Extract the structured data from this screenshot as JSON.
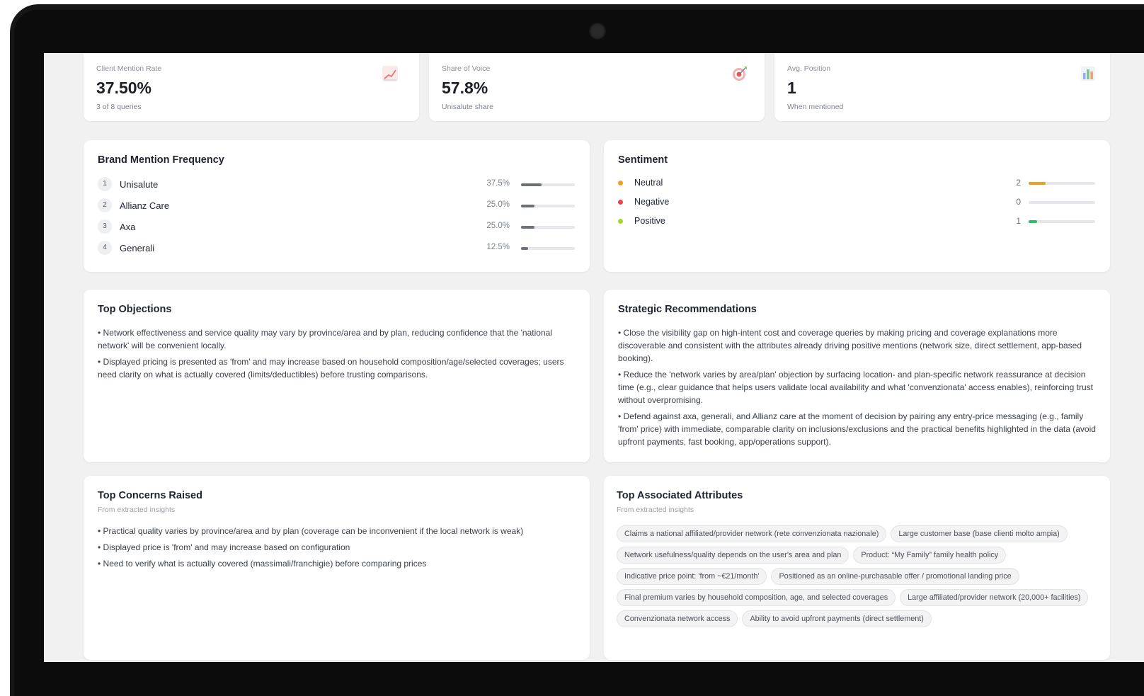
{
  "kpis": [
    {
      "label": "Client Mention Rate",
      "value": "37.50%",
      "sub": "3 of 8 queries",
      "icon": "trend-line-icon"
    },
    {
      "label": "Share of Voice",
      "value": "57.8%",
      "sub": "Unisalute share",
      "icon": "target-icon"
    },
    {
      "label": "Avg. Position",
      "value": "1",
      "sub": "When mentioned",
      "icon": "bar-chart-icon"
    }
  ],
  "brand_frequency": {
    "title": "Brand Mention Frequency",
    "items": [
      {
        "rank": "1",
        "name": "Unisalute",
        "pct_label": "37.5%",
        "share": 0.375
      },
      {
        "rank": "2",
        "name": "Allianz Care",
        "pct_label": "25.0%",
        "share": 0.25
      },
      {
        "rank": "3",
        "name": "Axa",
        "pct_label": "25.0%",
        "share": 0.25
      },
      {
        "rank": "4",
        "name": "Generali",
        "pct_label": "12.5%",
        "share": 0.125
      }
    ]
  },
  "sentiment": {
    "title": "Sentiment",
    "items": [
      {
        "name": "Neutral",
        "count": "2",
        "color": "#f0a020",
        "share": 0.25
      },
      {
        "name": "Negative",
        "count": "0",
        "color": "#ef4444",
        "share": 0
      },
      {
        "name": "Positive",
        "count": "1",
        "color": "#a3d62e",
        "bar_color": "#22c55e",
        "share": 0.125
      }
    ]
  },
  "objections": {
    "title": "Top Objections",
    "items": [
      "• Network effectiveness and service quality may vary by province/area and by plan, reducing confidence that the 'national network' will be convenient locally.",
      "• Displayed pricing is presented as 'from' and may increase based on household composition/age/selected coverages; users need clarity on what is actually covered (limits/deductibles) before trusting comparisons."
    ]
  },
  "recommendations": {
    "title": "Strategic Recommendations",
    "items": [
      "• Close the visibility gap on high-intent cost and coverage queries by making pricing and coverage explanations more discoverable and consistent with the attributes already driving positive mentions (network size, direct settlement, app-based booking).",
      "• Reduce the 'network varies by area/plan' objection by surfacing location- and plan-specific network reassurance at decision time (e.g., clear guidance that helps users validate local availability and what 'convenzionata' access enables), reinforcing trust without overpromising.",
      "• Defend against axa, generali, and Allianz care at the moment of decision by pairing any entry-price messaging (e.g., family 'from' price) with immediate, comparable clarity on inclusions/exclusions and the practical benefits highlighted in the data (avoid upfront payments, fast booking, app/operations support)."
    ]
  },
  "concerns": {
    "title": "Top Concerns Raised",
    "subtitle": "From extracted insights",
    "items": [
      "• Practical quality varies by province/area and by plan (coverage can be inconvenient if the local network is weak)",
      "• Displayed price is 'from' and may increase based on configuration",
      "• Need to verify what is actually covered (massimali/franchigie) before comparing prices"
    ]
  },
  "attributes": {
    "title": "Top Associated Attributes",
    "subtitle": "From extracted insights",
    "chips": [
      "Claims a national affiliated/provider network (rete convenzionata nazionale)",
      "Large customer base (base clienti molto ampia)",
      "Network usefulness/quality depends on the user's area and plan",
      "Product: “My Family” family health policy",
      "Indicative price point: 'from ~€21/month'",
      "Positioned as an online-purchasable offer / promotional landing price",
      "Final premium varies by household composition, age, and selected coverages",
      "Large affiliated/provider network (20,000+ facilities)",
      "Convenzionata network access",
      "Ability to avoid upfront payments (direct settlement)"
    ]
  }
}
